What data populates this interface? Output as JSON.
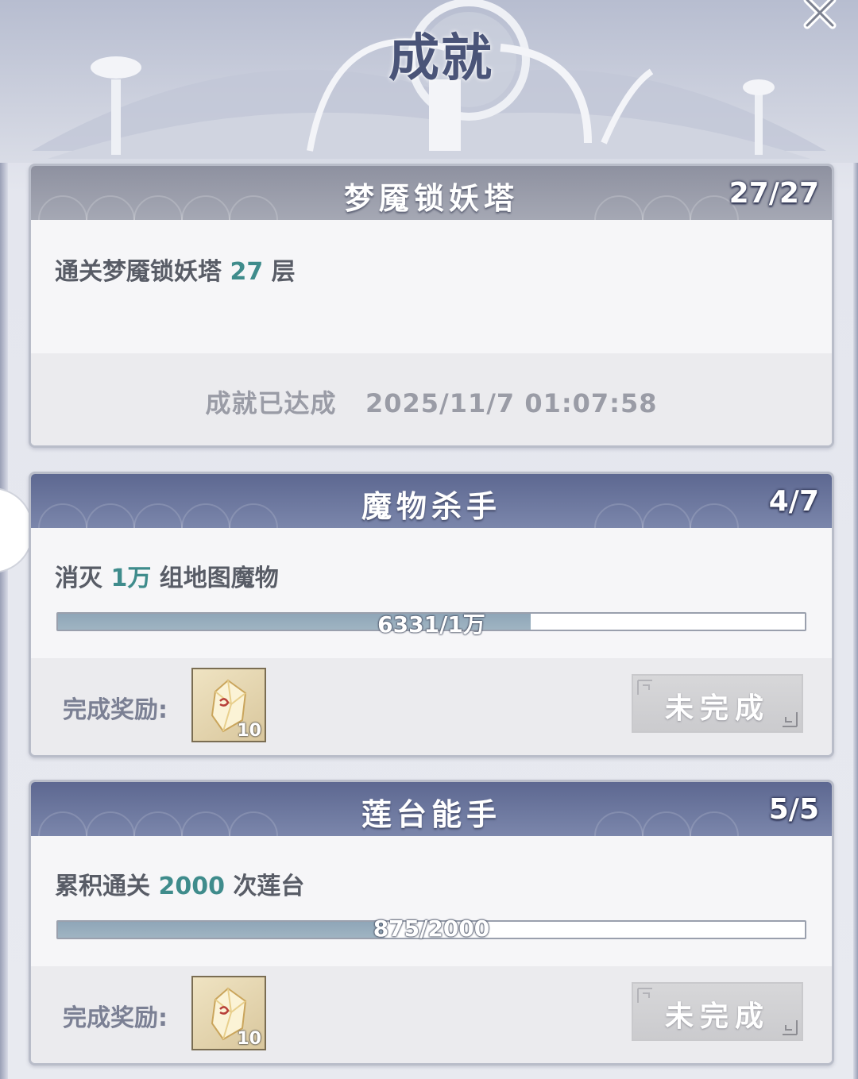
{
  "header": {
    "title": "成就"
  },
  "close_icon": "close-icon",
  "achievements": [
    {
      "title": "梦魇锁妖塔",
      "count": "27/27",
      "desc_prefix": "通关梦魇锁妖塔 ",
      "desc_highlight": "27",
      "desc_suffix": " 层",
      "status": "成就已达成",
      "completed_at": "2025/11/7 01:07:58",
      "header_color": "#9b9eab"
    },
    {
      "title": "魔物杀手",
      "count": "4/7",
      "desc_prefix": "消灭 ",
      "desc_highlight": "1万",
      "desc_suffix": " 组地图魔物",
      "progress_text": "6331/1万",
      "progress": 0.6331,
      "reward_label": "完成奖励:",
      "reward_qty": "10",
      "reward_icon": "crystal-icon",
      "button_label": "未完成",
      "header_color": "#6b769e"
    },
    {
      "title": "莲台能手",
      "count": "5/5",
      "desc_prefix": "累积通关 ",
      "desc_highlight": "2000",
      "desc_suffix": " 次莲台",
      "progress_text": "875/2000",
      "progress": 0.4375,
      "reward_label": "完成奖励:",
      "reward_qty": "10",
      "reward_icon": "crystal-icon",
      "button_label": "未完成",
      "header_color": "#6b769e"
    }
  ],
  "colors": {
    "highlight": "#3f8c8c",
    "progress_fill": "#94aabb",
    "text": "#585c66"
  }
}
